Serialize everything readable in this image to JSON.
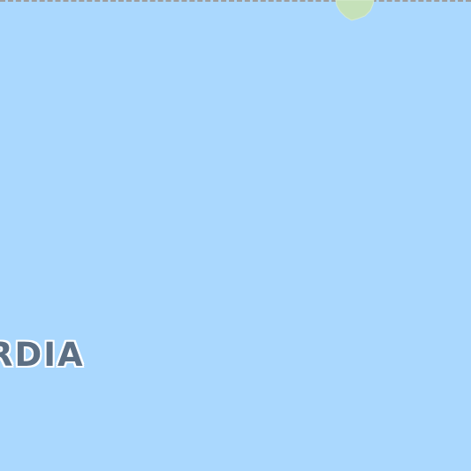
{
  "map": {
    "water_color": "#aad8fe",
    "land_color": "#c5e1b9",
    "boundary_color": "#9e9e9e",
    "boundary_style": "dashed",
    "label_color": "#5c6f84",
    "label_halo_color": "#ffffff",
    "region_label": "RDIA"
  }
}
